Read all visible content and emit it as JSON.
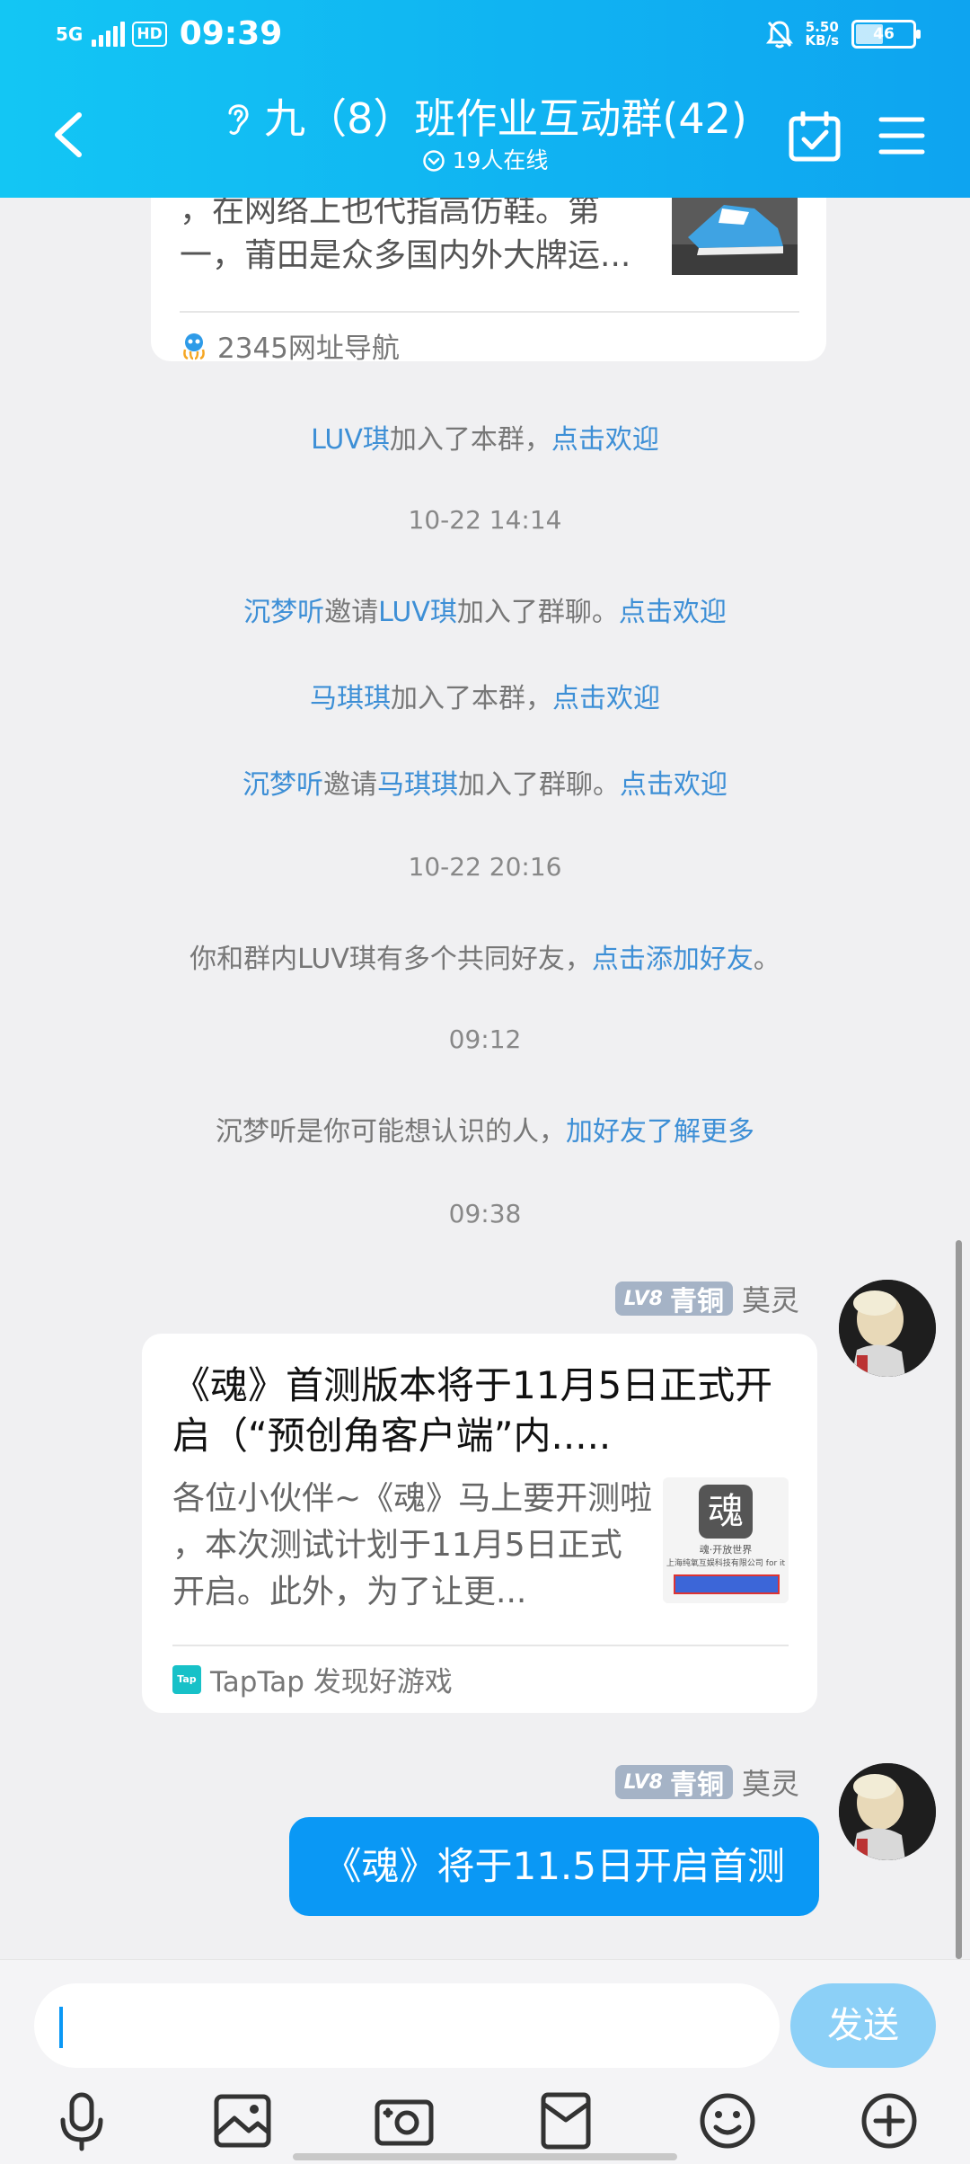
{
  "status_bar": {
    "network": "5G",
    "hd": "HD",
    "time": "09:39",
    "speed_value": "5.50",
    "speed_unit": "KB/s",
    "battery": "46"
  },
  "header": {
    "title": "九（8）班作业互动群(42)",
    "online": "19人在线"
  },
  "top_card": {
    "text_line1": "，在网络上也代指高仿鞋。第",
    "text_line2": "一，莆田是众多国内外大牌运...",
    "source": "2345网址导航"
  },
  "system_messages": [
    {
      "parts": [
        {
          "t": "LUV琪",
          "blue": true
        },
        {
          "t": "加入了本群，",
          "blue": false
        },
        {
          "t": "点击欢迎",
          "blue": true
        }
      ]
    },
    {
      "ts": "10-22 14:14"
    },
    {
      "parts": [
        {
          "t": "沉梦听",
          "blue": true
        },
        {
          "t": "邀请",
          "blue": false
        },
        {
          "t": "LUV琪",
          "blue": true
        },
        {
          "t": "加入了群聊。",
          "blue": false
        },
        {
          "t": "点击欢迎",
          "blue": true
        }
      ]
    },
    {
      "parts": [
        {
          "t": "马琪琪",
          "blue": true
        },
        {
          "t": "加入了本群，",
          "blue": false
        },
        {
          "t": "点击欢迎",
          "blue": true
        }
      ]
    },
    {
      "parts": [
        {
          "t": "沉梦听",
          "blue": true
        },
        {
          "t": "邀请",
          "blue": false
        },
        {
          "t": "马琪琪",
          "blue": true
        },
        {
          "t": "加入了群聊。",
          "blue": false
        },
        {
          "t": "点击欢迎",
          "blue": true
        }
      ]
    },
    {
      "ts": "10-22 20:16"
    },
    {
      "parts": [
        {
          "t": "你和群内LUV琪有多个共同好友，",
          "blue": false
        },
        {
          "t": "点击添加好友",
          "blue": true
        },
        {
          "t": "。",
          "blue": false
        }
      ]
    },
    {
      "ts": "09:12"
    },
    {
      "parts": [
        {
          "t": "沉梦听是你可能想认识的人，",
          "blue": false
        },
        {
          "t": "加好友了解更多",
          "blue": true
        }
      ]
    },
    {
      "ts": "09:38"
    }
  ],
  "sender": {
    "level": "LV8",
    "rank": "青铜",
    "name": "莫灵"
  },
  "share_card": {
    "title_line1": "《魂》首测版本将于11月5日正式开",
    "title_line2": "启（“预创角客户端”内.....",
    "desc_line1": "各位小伙伴~《魂》马上要开测啦",
    "desc_line2": "，本次测试计划于11月5日正式",
    "desc_line3": "开启。此外，为了让更...",
    "thumb_caption": "魂·开放世界",
    "thumb_company": "上海纯氧互娱科技有限公司 for it",
    "source_badge": "Tap",
    "source": "TapTap 发现好游戏"
  },
  "text_message": "《魂》将于11.5日开启首测",
  "input": {
    "placeholder": "",
    "send_label": "发送"
  },
  "colors": {
    "header_start": "#13c6f4",
    "header_end": "#0ea4f0",
    "link_blue": "#3d8fd6",
    "bubble_blue": "#0a98f5",
    "send_disabled": "#8cd0f7"
  },
  "icons": [
    "back-arrow-icon",
    "ear-icon",
    "chevron-circle-icon",
    "calendar-check-icon",
    "menu-icon",
    "mic-icon",
    "image-icon",
    "camera-icon",
    "red-packet-icon",
    "emoji-icon",
    "plus-icon"
  ]
}
